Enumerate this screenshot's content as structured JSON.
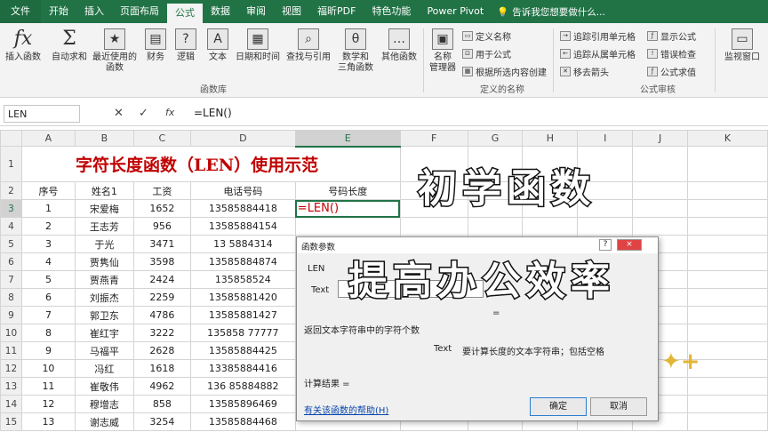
{
  "tabs": [
    "文件",
    "开始",
    "插入",
    "页面布局",
    "公式",
    "数据",
    "审阅",
    "视图",
    "福昕PDF",
    "特色功能",
    "Power Pivot"
  ],
  "tell_me": "告诉我您想要做什么...",
  "ribbon": {
    "insert_function": "插入函数",
    "autosum": "自动求和",
    "recent": "最近使用的\n函数",
    "financial": "财务",
    "logical": "逻辑",
    "text": "文本",
    "datetime": "日期和时间",
    "lookup": "查找与引用",
    "math": "数学和\n三角函数",
    "other": "其他函数",
    "library_group": "函数库",
    "name_manager": "名称\n管理器",
    "define_name": "定义名称",
    "use_in_formula": "用于公式",
    "create_from_sel": "根据所选内容创建",
    "names_group": "定义的名称",
    "trace_precedents": "追踪引用单元格",
    "trace_dependents": "追踪从属单元格",
    "remove_arrows": "移去箭头",
    "show_formulas": "显示公式",
    "error_checking": "错误检查",
    "evaluate": "公式求值",
    "audit_group": "公式审核",
    "watch_window": "监视窗口"
  },
  "formula_bar": {
    "name_box": "LEN",
    "cancel": "✕",
    "enter": "✓",
    "fx": "fx",
    "formula": "=LEN()"
  },
  "columns": [
    "A",
    "B",
    "C",
    "D",
    "E",
    "F",
    "G",
    "H",
    "I",
    "J",
    "K"
  ],
  "title": "字符长度函数（LEN）使用示范",
  "headers": [
    "序号",
    "姓名1",
    "工资",
    "电话号码",
    "号码长度"
  ],
  "rows": [
    [
      "1",
      "宋爱梅",
      "1652",
      "13585884418",
      "=LEN()"
    ],
    [
      "2",
      "王志芳",
      "956",
      "13585884154",
      ""
    ],
    [
      "3",
      "于光",
      "3471",
      "13 5884314",
      ""
    ],
    [
      "4",
      "贾隽仙",
      "3598",
      "13585884874",
      ""
    ],
    [
      "5",
      "贾燕青",
      "2424",
      "135858524",
      ""
    ],
    [
      "6",
      "刘振杰",
      "2259",
      "13585881420",
      ""
    ],
    [
      "7",
      "郭卫东",
      "4786",
      "13585881427",
      ""
    ],
    [
      "8",
      "崔红宇",
      "3222",
      "135858 77777",
      ""
    ],
    [
      "9",
      "马福平",
      "2628",
      "13585884425",
      ""
    ],
    [
      "10",
      "冯红",
      "1618",
      "13385884416",
      ""
    ],
    [
      "11",
      "崔敬伟",
      "4962",
      "136 85884882",
      ""
    ],
    [
      "12",
      "穆增志",
      "858",
      "13585896469",
      ""
    ],
    [
      "13",
      "谢志威",
      "3254",
      "13585884468",
      ""
    ]
  ],
  "overlay": {
    "line1": "初学函数",
    "line2": "提高办公效率"
  },
  "dialog": {
    "title": "函数参数",
    "help_btn": "?",
    "close_btn": "×",
    "function_name": "LEN",
    "arg_label": "Text",
    "equals": "=",
    "description": "返回文本字符串中的字符个数",
    "arg_name": "Text",
    "arg_desc": "要计算长度的文本字符串；包括空格",
    "result": "计算结果 =",
    "help_link": "有关该函数的帮助(H)",
    "ok": "确定",
    "cancel": "取消"
  }
}
